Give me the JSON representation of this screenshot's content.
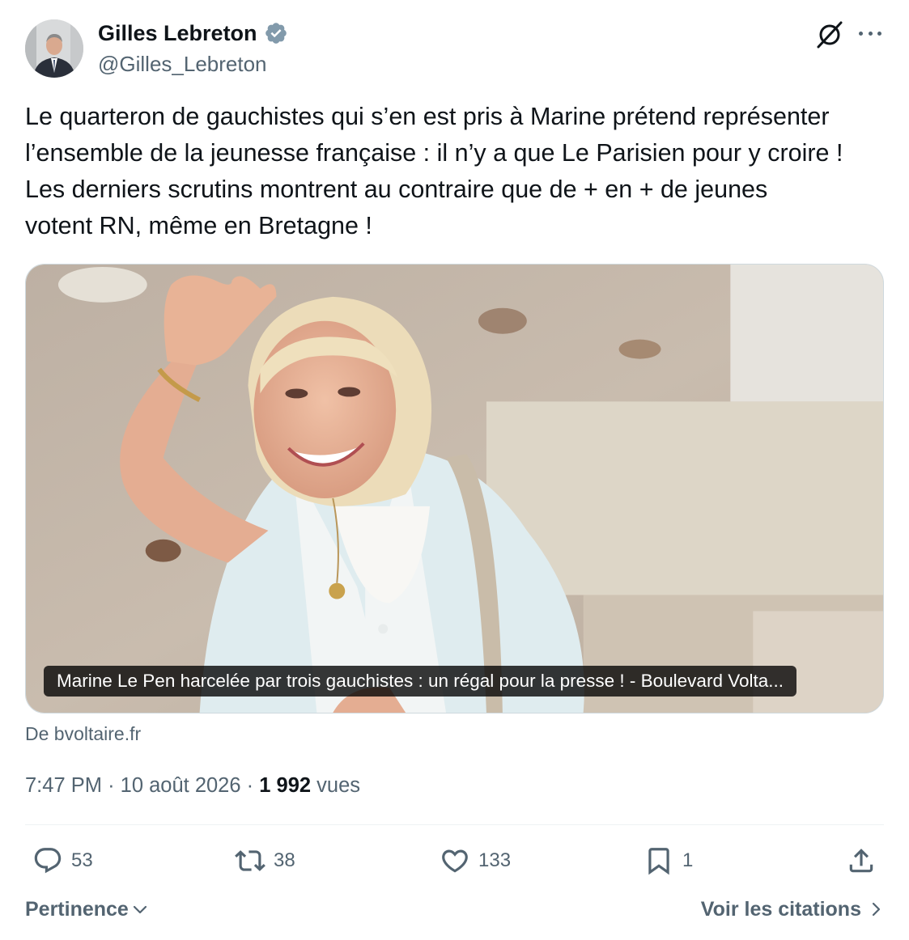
{
  "author": {
    "name": "Gilles Lebreton",
    "handle": "@Gilles_Lebreton",
    "verified": true
  },
  "tweet": {
    "text": "Le quarteron de gauchistes qui s’en est pris à Marine prétend représenter\nl’ensemble de la jeunesse française : il n’y a que Le Parisien pour y croire !\nLes derniers scrutins montrent au contraire que de + en + de jeunes\nvotent RN, même en Bretagne !"
  },
  "card": {
    "caption": "Marine Le Pen harcelée par trois gauchistes : un régal pour la presse ! - Boulevard Volta...",
    "source": "De bvoltaire.fr"
  },
  "meta": {
    "time": "7:47 PM",
    "date": "10 août 2026",
    "views_count": "1 992",
    "views_label": "vues",
    "separator": "·"
  },
  "actions": {
    "replies": "53",
    "retweets": "38",
    "likes": "133",
    "bookmarks": "1"
  },
  "footer": {
    "sort_label": "Pertinence",
    "quotes_label": "Voir les citations"
  },
  "colors": {
    "text": "#0f1419",
    "secondary": "#536471",
    "verified": "#829aab",
    "divider": "#eff3f4"
  },
  "icons": [
    "verified-badge-icon",
    "grok-icon",
    "more-icon",
    "reply-icon",
    "retweet-icon",
    "like-icon",
    "bookmark-icon",
    "share-icon",
    "chevron-down-icon",
    "chevron-right-icon"
  ]
}
